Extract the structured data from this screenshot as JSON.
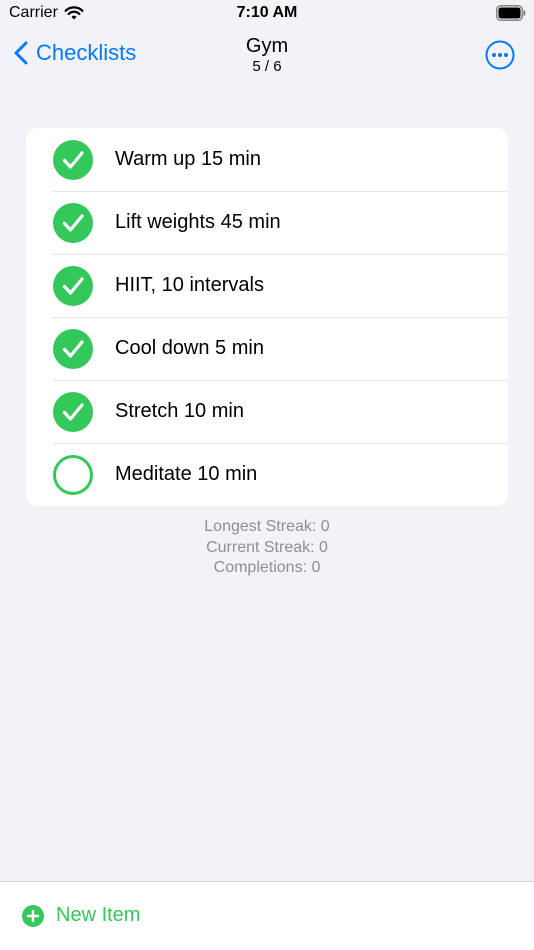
{
  "status_bar": {
    "carrier": "Carrier",
    "time": "7:10 AM",
    "wifi_icon": "wifi-icon",
    "battery_icon": "battery-full-icon"
  },
  "nav": {
    "back_label": "Checklists",
    "back_icon": "chevron-left-icon",
    "title": "Gym",
    "subtitle": "5 / 6",
    "more_icon": "ellipsis-circle-icon"
  },
  "checklist": {
    "items": [
      {
        "label": "Warm up 15 min",
        "checked": true
      },
      {
        "label": "Lift weights 45 min",
        "checked": true
      },
      {
        "label": "HIIT, 10 intervals",
        "checked": true
      },
      {
        "label": "Cool down 5 min",
        "checked": true
      },
      {
        "label": "Stretch 10 min",
        "checked": true
      },
      {
        "label": "Meditate 10 min",
        "checked": false
      }
    ]
  },
  "stats": {
    "longest_streak": "Longest Streak: 0",
    "current_streak": "Current Streak: 0",
    "completions": "Completions: 0"
  },
  "toolbar": {
    "new_item_label": "New Item",
    "new_item_icon": "plus-circle-icon"
  },
  "colors": {
    "accent_blue": "#007aff",
    "check_green": "#34c759",
    "background": "#f2f2f7",
    "secondary_text": "#8e8e93"
  }
}
